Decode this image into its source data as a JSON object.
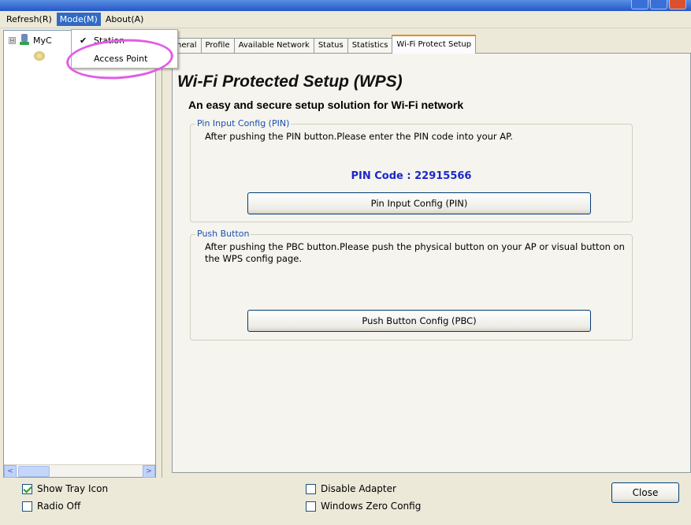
{
  "menubar": {
    "items": [
      "Refresh(R)",
      "Mode(M)",
      "About(A)"
    ],
    "active_index": 1
  },
  "mode_menu": {
    "items": [
      {
        "label": "Station",
        "checked": true
      },
      {
        "label": "Access Point",
        "checked": false
      }
    ]
  },
  "tree": {
    "root_label": "MyC",
    "expander": "⊟"
  },
  "tabs": [
    {
      "label": "neral",
      "active": false
    },
    {
      "label": "Profile",
      "active": false
    },
    {
      "label": "Available Network",
      "active": false
    },
    {
      "label": "Status",
      "active": false
    },
    {
      "label": "Statistics",
      "active": false
    },
    {
      "label": "Wi-Fi Protect Setup",
      "active": true
    }
  ],
  "wps": {
    "title": "Wi-Fi Protected Setup (WPS)",
    "subtitle": "An easy and secure setup solution for Wi-Fi network",
    "pin_group": {
      "legend": "Pin Input Config (PIN)",
      "text": "After pushing the PIN button.Please enter the PIN code into your AP.",
      "pin_code": "PIN Code :  22915566",
      "button": "Pin Input Config (PIN)"
    },
    "pbc_group": {
      "legend": "Push Button",
      "text": "After pushing the PBC button.Please push the physical button on your AP or visual button on the WPS config page.",
      "button": "Push Button Config (PBC)"
    }
  },
  "bottom": {
    "left_checks": [
      {
        "label": "Show Tray Icon",
        "checked": true
      },
      {
        "label": "Radio Off",
        "checked": false
      }
    ],
    "mid_checks": [
      {
        "label": "Disable Adapter",
        "checked": false
      },
      {
        "label": "Windows Zero Config",
        "checked": false
      }
    ],
    "close_button": "Close"
  },
  "scroll": {
    "left_arrow": "<",
    "right_arrow": ">"
  }
}
